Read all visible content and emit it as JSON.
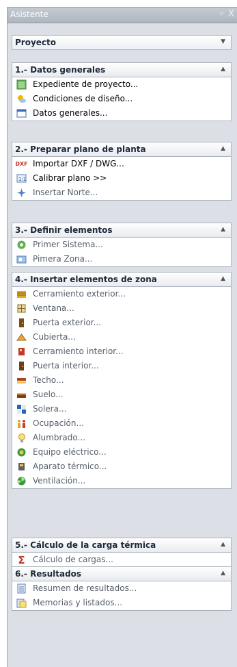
{
  "panel": {
    "title": "Asistente",
    "pin": "ᵖ",
    "close": "X"
  },
  "project": {
    "label": "Proyecto"
  },
  "sections": [
    {
      "title": "1.- Datos generales",
      "items": [
        {
          "label": "Expediente de proyecto...",
          "icon": "expediente-icon",
          "enabled": true
        },
        {
          "label": "Condiciones de diseño...",
          "icon": "sun-cloud-icon",
          "enabled": true
        },
        {
          "label": "Datos generales...",
          "icon": "window-icon",
          "enabled": true
        }
      ]
    },
    {
      "title": "2.- Preparar plano de planta",
      "items": [
        {
          "label": "Importar DXF / DWG...",
          "icon": "dxf-icon",
          "enabled": true
        },
        {
          "label": "Calibrar plano >>",
          "icon": "calibrate-icon",
          "enabled": true
        },
        {
          "label": "Insertar Norte...",
          "icon": "compass-icon",
          "enabled": false
        }
      ]
    },
    {
      "title": "3.- Definir elementos",
      "items": [
        {
          "label": "Primer Sistema...",
          "icon": "system-icon",
          "enabled": false
        },
        {
          "label": "Pimera Zona...",
          "icon": "zone-icon",
          "enabled": false
        }
      ]
    },
    {
      "title": "4.- Insertar elementos de zona",
      "items": [
        {
          "label": "Cerramiento exterior...",
          "icon": "exterior-wall-icon",
          "enabled": false
        },
        {
          "label": "Ventana...",
          "icon": "window-grid-icon",
          "enabled": false
        },
        {
          "label": "Puerta exterior...",
          "icon": "exterior-door-icon",
          "enabled": false
        },
        {
          "label": "Cubierta...",
          "icon": "roof-icon",
          "enabled": false
        },
        {
          "label": "Cerramiento interior...",
          "icon": "interior-wall-icon",
          "enabled": false
        },
        {
          "label": "Puerta interior...",
          "icon": "interior-door-icon",
          "enabled": false
        },
        {
          "label": "Techo...",
          "icon": "ceiling-icon",
          "enabled": false
        },
        {
          "label": "Suelo...",
          "icon": "floor-icon",
          "enabled": false
        },
        {
          "label": "Solera...",
          "icon": "slab-icon",
          "enabled": false
        },
        {
          "label": "Ocupación...",
          "icon": "people-icon",
          "enabled": false
        },
        {
          "label": "Alumbrado...",
          "icon": "light-bulb-icon",
          "enabled": false
        },
        {
          "label": "Equipo eléctrico...",
          "icon": "electric-equipment-icon",
          "enabled": false
        },
        {
          "label": "Aparato térmico...",
          "icon": "thermal-device-icon",
          "enabled": false
        },
        {
          "label": "Ventilación...",
          "icon": "fan-icon",
          "enabled": false
        }
      ]
    },
    {
      "title": "5.- Cálculo de la carga térmica",
      "items": [
        {
          "label": "Cálculo de cargas...",
          "icon": "sigma-icon",
          "enabled": false
        }
      ]
    },
    {
      "title": "6.- Resultados",
      "items": [
        {
          "label": "Resumen de resultados...",
          "icon": "summary-icon",
          "enabled": false
        },
        {
          "label": "Memorias y listados...",
          "icon": "reports-icon",
          "enabled": false
        }
      ]
    }
  ]
}
